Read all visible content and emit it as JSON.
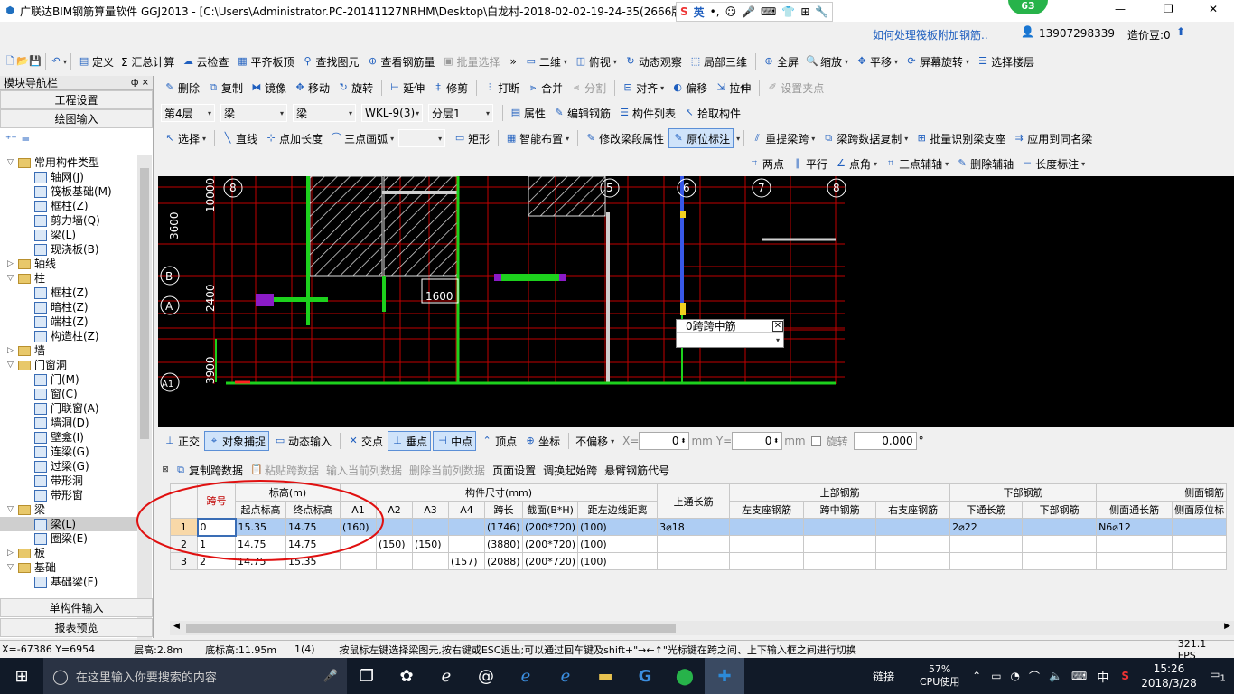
{
  "window": {
    "title": "广联达BIM钢筋算量软件 GGJ2013 - [C:\\Users\\Administrator.PC-20141127NRHM\\Desktop\\白龙村-2018-02-02-19-24-35(2666版",
    "ime_label": "英",
    "help_link": "如何处理筏板附加钢筋..",
    "phone": "13907298339",
    "price_label": "造价豆:0",
    "badge": "63",
    "controls": [
      "—",
      "❐",
      "✕"
    ]
  },
  "menu1": [
    "定义",
    "Σ 汇总计算",
    "云检查",
    "平齐板顶",
    "查找图元",
    "查看钢筋量",
    "批量选择",
    "二维",
    "俯视",
    "动态观察",
    "局部三维",
    "全屏",
    "缩放",
    "平移",
    "屏幕旋转",
    "选择楼层"
  ],
  "menu2": [
    "删除",
    "复制",
    "镜像",
    "移动",
    "旋转",
    "延伸",
    "修剪",
    "打断",
    "合并",
    "分割",
    "对齐",
    "偏移",
    "拉伸",
    "设置夹点"
  ],
  "menu3": {
    "floor": "第4层",
    "type1": "梁",
    "type2": "梁",
    "comp": "WKL-9(3)",
    "layer": "分层1",
    "buttons": [
      "属性",
      "编辑钢筋",
      "构件列表",
      "拾取构件"
    ]
  },
  "menu4": [
    "选择",
    "直线",
    "点加长度",
    "三点画弧",
    "矩形",
    "智能布置",
    "修改梁段属性",
    "原位标注",
    "重提梁跨",
    "梁跨数据复制",
    "批量识别梁支座",
    "应用到同名梁"
  ],
  "menu5": [
    "两点",
    "平行",
    "点角",
    "三点辅轴",
    "删除辅轴",
    "长度标注"
  ],
  "nav": {
    "title": "模块导航栏",
    "pin": "ф ×",
    "btn1": "工程设置",
    "btn2": "绘图输入",
    "btn3": "单构件输入",
    "btn4": "报表预览"
  },
  "tree": [
    {
      "t": "常用构件类型",
      "lv": 0,
      "f": 1,
      "o": "▽"
    },
    {
      "t": "轴网(J)",
      "lv": 1
    },
    {
      "t": "筏板基础(M)",
      "lv": 1
    },
    {
      "t": "框柱(Z)",
      "lv": 1
    },
    {
      "t": "剪力墙(Q)",
      "lv": 1
    },
    {
      "t": "梁(L)",
      "lv": 1
    },
    {
      "t": "现浇板(B)",
      "lv": 1
    },
    {
      "t": "轴线",
      "lv": 0,
      "f": 1,
      "o": "▷"
    },
    {
      "t": "柱",
      "lv": 0,
      "f": 1,
      "o": "▽"
    },
    {
      "t": "框柱(Z)",
      "lv": 1
    },
    {
      "t": "暗柱(Z)",
      "lv": 1
    },
    {
      "t": "端柱(Z)",
      "lv": 1
    },
    {
      "t": "构造柱(Z)",
      "lv": 1
    },
    {
      "t": "墙",
      "lv": 0,
      "f": 1,
      "o": "▷"
    },
    {
      "t": "门窗洞",
      "lv": 0,
      "f": 1,
      "o": "▽"
    },
    {
      "t": "门(M)",
      "lv": 1
    },
    {
      "t": "窗(C)",
      "lv": 1
    },
    {
      "t": "门联窗(A)",
      "lv": 1
    },
    {
      "t": "墙洞(D)",
      "lv": 1
    },
    {
      "t": "壁龛(I)",
      "lv": 1
    },
    {
      "t": "连梁(G)",
      "lv": 1
    },
    {
      "t": "过梁(G)",
      "lv": 1
    },
    {
      "t": "带形洞",
      "lv": 1
    },
    {
      "t": "带形窗",
      "lv": 1
    },
    {
      "t": "梁",
      "lv": 0,
      "f": 1,
      "o": "▽"
    },
    {
      "t": "梁(L)",
      "lv": 1,
      "sel": 1
    },
    {
      "t": "圈梁(E)",
      "lv": 1
    },
    {
      "t": "板",
      "lv": 0,
      "f": 1,
      "o": "▷"
    },
    {
      "t": "基础",
      "lv": 0,
      "f": 1,
      "o": "▽"
    },
    {
      "t": "基础梁(F)",
      "lv": 1
    }
  ],
  "canvas": {
    "axis_top": [
      "8",
      "5",
      "6",
      "7",
      "8"
    ],
    "axis_left": [
      "B",
      "A",
      "A1"
    ],
    "dims": [
      "3600",
      "10000",
      "2400",
      "1600",
      "3900"
    ],
    "popup_label": "0跨跨中筋"
  },
  "snapbar": [
    "正交",
    "对象捕捉",
    "动态输入",
    "交点",
    "垂点",
    "中点",
    "顶点",
    "坐标",
    "不偏移"
  ],
  "snap_inputs": {
    "x_label": "X=",
    "x": "0",
    "mm1": "mm",
    "y_label": "Y=",
    "y": "0",
    "mm2": "mm",
    "rot": "旋转",
    "rot_val": "0.000",
    "deg": "°"
  },
  "gridtools": [
    "复制跨数据",
    "粘贴跨数据",
    "输入当前列数据",
    "删除当前列数据",
    "页面设置",
    "调换起始跨",
    "悬臂钢筋代号"
  ],
  "table": {
    "h1": [
      "跨号",
      "标高(m)",
      "构件尺寸(mm)",
      "上通长筋",
      "上部钢筋",
      "下部钢筋",
      "侧面钢筋"
    ],
    "h2": [
      "起点标高",
      "终点标高",
      "A1",
      "A2",
      "A3",
      "A4",
      "跨长",
      "截面(B*H)",
      "距左边线距离",
      "左支座钢筋",
      "跨中钢筋",
      "右支座钢筋",
      "下通长筋",
      "下部钢筋",
      "侧面通长筋",
      "侧面原位标"
    ],
    "rows": [
      [
        "1",
        "0",
        "15.35",
        "14.75",
        "(160)",
        "",
        "",
        "",
        "(1746)",
        "(200*720)",
        "(100)",
        "3⌀18",
        "",
        "",
        "",
        "2⌀22",
        "",
        "N6⌀12",
        ""
      ],
      [
        "2",
        "1",
        "14.75",
        "14.75",
        "",
        "(150)",
        "(150)",
        "",
        "(3880)",
        "(200*720)",
        "(100)",
        "",
        "",
        "",
        "",
        "",
        "",
        "",
        ""
      ],
      [
        "3",
        "2",
        "14.75",
        "15.35",
        "",
        "",
        "",
        "(157)",
        "(2088)",
        "(200*720)",
        "(100)",
        "",
        "",
        "",
        "",
        "",
        "",
        "",
        ""
      ]
    ]
  },
  "status": {
    "coord": "X=-67386 Y=6954",
    "floor_h": "层高:2.8m",
    "base_h": "底标高:11.95m",
    "count": "1(4)",
    "hint": "按鼠标左键选择梁图元,按右键或ESC退出;可以通过回车键及shift+\"→←↑\"光标键在跨之间、上下输入框之间进行切换",
    "fps": "321.1 FPS"
  },
  "taskbar": {
    "search": "在这里输入你要搜索的内容",
    "link": "链接",
    "cpu": "57%",
    "cpu_label": "CPU使用",
    "lang": "中",
    "time": "15:26",
    "date": "2018/3/28",
    "notif": "1"
  },
  "colors": {
    "canvas_bg": "#000000",
    "grid_red": "#c00000",
    "beam_green": "#1dd11d",
    "purple": "#8b1bc7",
    "selected_row": "#aecdf3",
    "accent": "#1f5fbf"
  }
}
